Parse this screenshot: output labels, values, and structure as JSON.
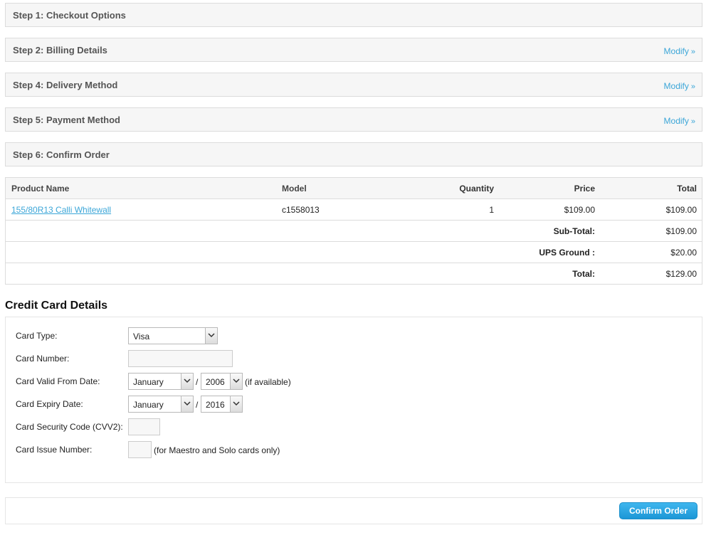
{
  "steps": {
    "checkout_options": "Step 1: Checkout Options",
    "billing_details": "Step 2: Billing Details",
    "delivery_method": "Step 4: Delivery Method",
    "payment_method": "Step 5: Payment Method",
    "confirm_order": "Step 6: Confirm Order",
    "modify_label": "Modify",
    "modify_arrow": "»"
  },
  "cart": {
    "columns": {
      "name": "Product Name",
      "model": "Model",
      "quantity": "Quantity",
      "price": "Price",
      "total": "Total"
    },
    "items": [
      {
        "name": "155/80R13 Calli Whitewall",
        "model": "c1558013",
        "quantity": "1",
        "price": "$109.00",
        "total": "$109.00"
      }
    ],
    "totals": [
      {
        "label": "Sub-Total:",
        "value": "$109.00"
      },
      {
        "label": "UPS Ground :",
        "value": "$20.00"
      },
      {
        "label": "Total:",
        "value": "$129.00"
      }
    ]
  },
  "credit_card": {
    "heading": "Credit Card Details",
    "card_type_label": "Card Type:",
    "card_type_value": "Visa",
    "card_number_label": "Card Number:",
    "card_number_value": "",
    "valid_from_label": "Card Valid From Date:",
    "valid_from_month": "January",
    "valid_from_year": "2006",
    "valid_from_note": "(if available)",
    "expiry_label": "Card Expiry Date:",
    "expiry_month": "January",
    "expiry_year": "2016",
    "date_separator": "/",
    "cvv_label": "Card Security Code (CVV2):",
    "cvv_value": "",
    "issue_label": "Card Issue Number:",
    "issue_value": "",
    "issue_note": "(for Maestro and Solo cards only)"
  },
  "confirm_button": "Confirm Order",
  "icons": {
    "dropdown": "chevron-down-icon"
  },
  "colors": {
    "link": "#3ba6d8",
    "button": "#1c97d6",
    "panel_bg": "#f6f6f6",
    "border": "#dcdcdc"
  }
}
